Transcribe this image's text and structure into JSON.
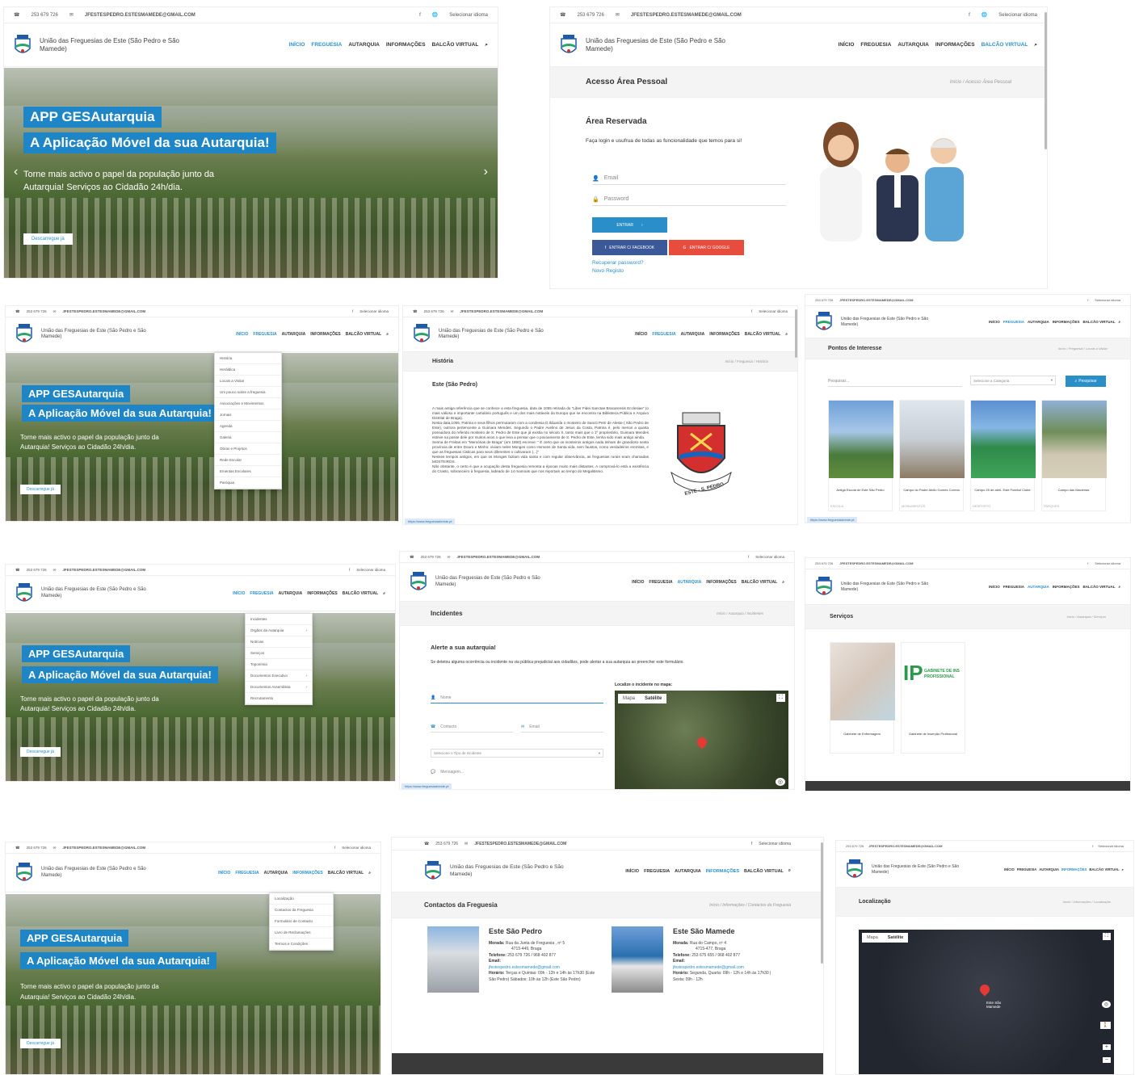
{
  "site": {
    "phone": "253 679 726",
    "email": "JFESTESPEDRO.ESTESMAMEDE@GMAIL.COM",
    "fb": "f",
    "lang": "Selecionar idioma",
    "brand": "União das Freguesias de Este (São Pedro e São Mamede)",
    "nav": [
      "INÍCIO",
      "FREGUESIA",
      "AUTARQUIA",
      "INFORMAÇÕES",
      "BALCÃO VIRTUAL"
    ]
  },
  "hero": {
    "band1": "APP GESAutarquia",
    "band2": "A Aplicação Móvel da sua Autarquia!",
    "text1": "Torne mais activo o papel da população junto da",
    "text2": "Autarquia! Serviços ao Cidadão 24h/dia.",
    "button": "Descarregue já"
  },
  "login": {
    "title": "Acesso Área Pessoal",
    "crumb": "Início  /  Acesso Área Pessoal",
    "heading": "Área Reservada",
    "sub": "Faça login e usufrua de todas as funcionalidade que temos para si!",
    "email": "Email",
    "password": "Password",
    "enter": "ENTRAR",
    "facebook": "ENTRAR C/ FACEBOOK",
    "google": "ENTRAR C/ GOOGLE",
    "recover": "Recuperar password?",
    "register": "Novo Registo"
  },
  "freguesia_menu": [
    "História",
    "Heráldica",
    "Locais a Visitar",
    "Um pouco sobre a freguesia",
    "Associações e Movimentos",
    "Jornais",
    "Agenda",
    "Galeria",
    "Obras e Projetos",
    "Rede Escolar",
    "Ementas Escolares",
    "Paróquia"
  ],
  "historia": {
    "title": "História",
    "crumb": "Início  /  Freguesia  /  História",
    "heading": "Este (São Pedro)",
    "p1": "A mais antiga referência que se conhece a esta freguesia, data de 1055 retirada do \"Liber Fidei Sanctae Bracarensis Ecclesiae\" (o mais valioso e importante cartulário português e um dos mais notáveis da Europa que se encontra na Biblioteca Pública e Arquivo Distrital de Braga).",
    "p2": "Nesta data,1055, Patrina e seus filhos permutaram com a condessa D.Ilduarda o mosteiro de Sancti Petri de Aleste ( São Pedro de Este), outrora pertencente a Guimara Mendes. Segundo o Padre Avelino de Jesus da Costa, Patrina é, pelo menos a quarta possuidora do referido mosteiro de S. Pedro de Este que já existia no século X, tanto mais que o 1º proprietário, Guimara Mendes esteve na posse dele por muitos anos o que leva a pensar que o povoamento de S. Pedro de Este, tenha sido mais antigo ainda.",
    "p3": "Senna de Freitas em \"Memórias de Braga\" (em 1890) escreve: \" É certo que os mosteiros antigos nada tinham de grandioso nesta província de entre Douro e Minho: viviam neles Monges como Homens de Santa vida, sem faustos, como verdadeiros eremitas, e que as freguesias rústicas para seus diferentes o cultivaram (...)\"",
    "p4": "Nesses tempos antigos, em que os Monges faziam vida santa e com regular observância, as freguesias rurais eram chamadas MOSTEIROS.",
    "p5": "Não obstante, o certo é que a ocupação desta freguesia remonta a épocas muito mais distantes. A comprová-lo está a existência do Crasto, sobranceiro à freguesia, ladeado de 14 mamoas que nos reportam ao tempo do Megalitismo.",
    "seal": "ESTE - S. PEDRO",
    "url": "https://www.freguesiadeeste.pt"
  },
  "pontos": {
    "title": "Pontos de Interesse",
    "crumb": "Início  /  Freguesia  /  Locais a Visitar",
    "search": "Pesquisar...",
    "category": "Selecione a Categoria",
    "button": "Pesquisar",
    "cards": [
      {
        "name": "Antiga Escola de Este São Pedro",
        "cat": "ESCOLA"
      },
      {
        "name": "Campo do Padre Abílio Gomes Correia",
        "cat": "MONUMENTOS"
      },
      {
        "name": "Campo 25 de abril- Este Futebol Clube",
        "cat": "DESPORTO"
      },
      {
        "name": "Campo das Macieiras",
        "cat": "PARQUES"
      }
    ]
  },
  "autarquia_menu": [
    "Incidentes",
    "Órgãos da Autarquia",
    "Notícias",
    "Serviços",
    "Toponímia",
    "Documentos Executivo",
    "Documentos Assembleia",
    "Recrutamento"
  ],
  "incidentes": {
    "title": "Incidentes",
    "crumb": "Início  /  Autarquia  /  Incidentes",
    "heading": "Alerte a sua autarquia!",
    "sub": "Se detetou alguma ocorrência ou incidente na via pública prejudicial aos cidadãos, pode alertar a sua autarquia ao preencher este formulário.",
    "name": "Nome",
    "contact": "Contacto",
    "email": "Email",
    "type": "Selecione o Tipo de Incidente",
    "message": "Mensagem...",
    "maplabel": "Localize o incidente no mapa:",
    "map": "Mapa",
    "sat": "Satélite"
  },
  "servicos": {
    "title": "Serviços",
    "crumb": "Início  /  Autarquia  /  Serviços",
    "cards": [
      "Gabinete de Enfermagem",
      "Gabinete de Inserção Profissional"
    ],
    "gip": "GABINETE DE INS PROFISSIONAL"
  },
  "info_menu": [
    "Localização",
    "Contactos da Freguesia",
    "Formulário de Contacto",
    "Livro de Reclamações",
    "Termos e Condições"
  ],
  "contactos": {
    "title": "Contactos da Freguesia",
    "crumb": "Início  /  Informações  /  Contactos da Freguesia",
    "a": {
      "name": "Este São Pedro",
      "morada": "Rua da Junta de Freguesia , nº 5",
      "cp": "4715-449, Braga",
      "tel": "253 679 726 / 968 402 877",
      "email": "jfestespedro.estesmamede@gmail.com",
      "horario": "Terças e Quintas: 09h - 12h e 14h às 17h30 (Este São Pedro) Sábados: 10h às 12h (Este São Pedro)"
    },
    "b": {
      "name": "Este São Mamede",
      "morada": "Rua do Campo, nº 4",
      "cp": "4715-477, Braga",
      "tel": "253 675 655 / 968 402 877",
      "email": "jfestespedro.estesmamede@gmail.com",
      "horario": "Segunda, Quarta: 09h - 12h e 14h às 17h30 | Sexta: 09h - 12h"
    },
    "labels": {
      "morada": "Morada:",
      "tel": "Telefone:",
      "email": "Email:",
      "horario": "Horário:"
    }
  },
  "localizacao": {
    "title": "Localização",
    "crumb": "Início  /  Informações  /  Localização",
    "map": "Mapa",
    "sat": "Satélite",
    "place": "Este São Mamede"
  },
  "colors": {
    "accent": "#2a8fc9",
    "facebook": "#3b5998",
    "google": "#e74c3c"
  }
}
